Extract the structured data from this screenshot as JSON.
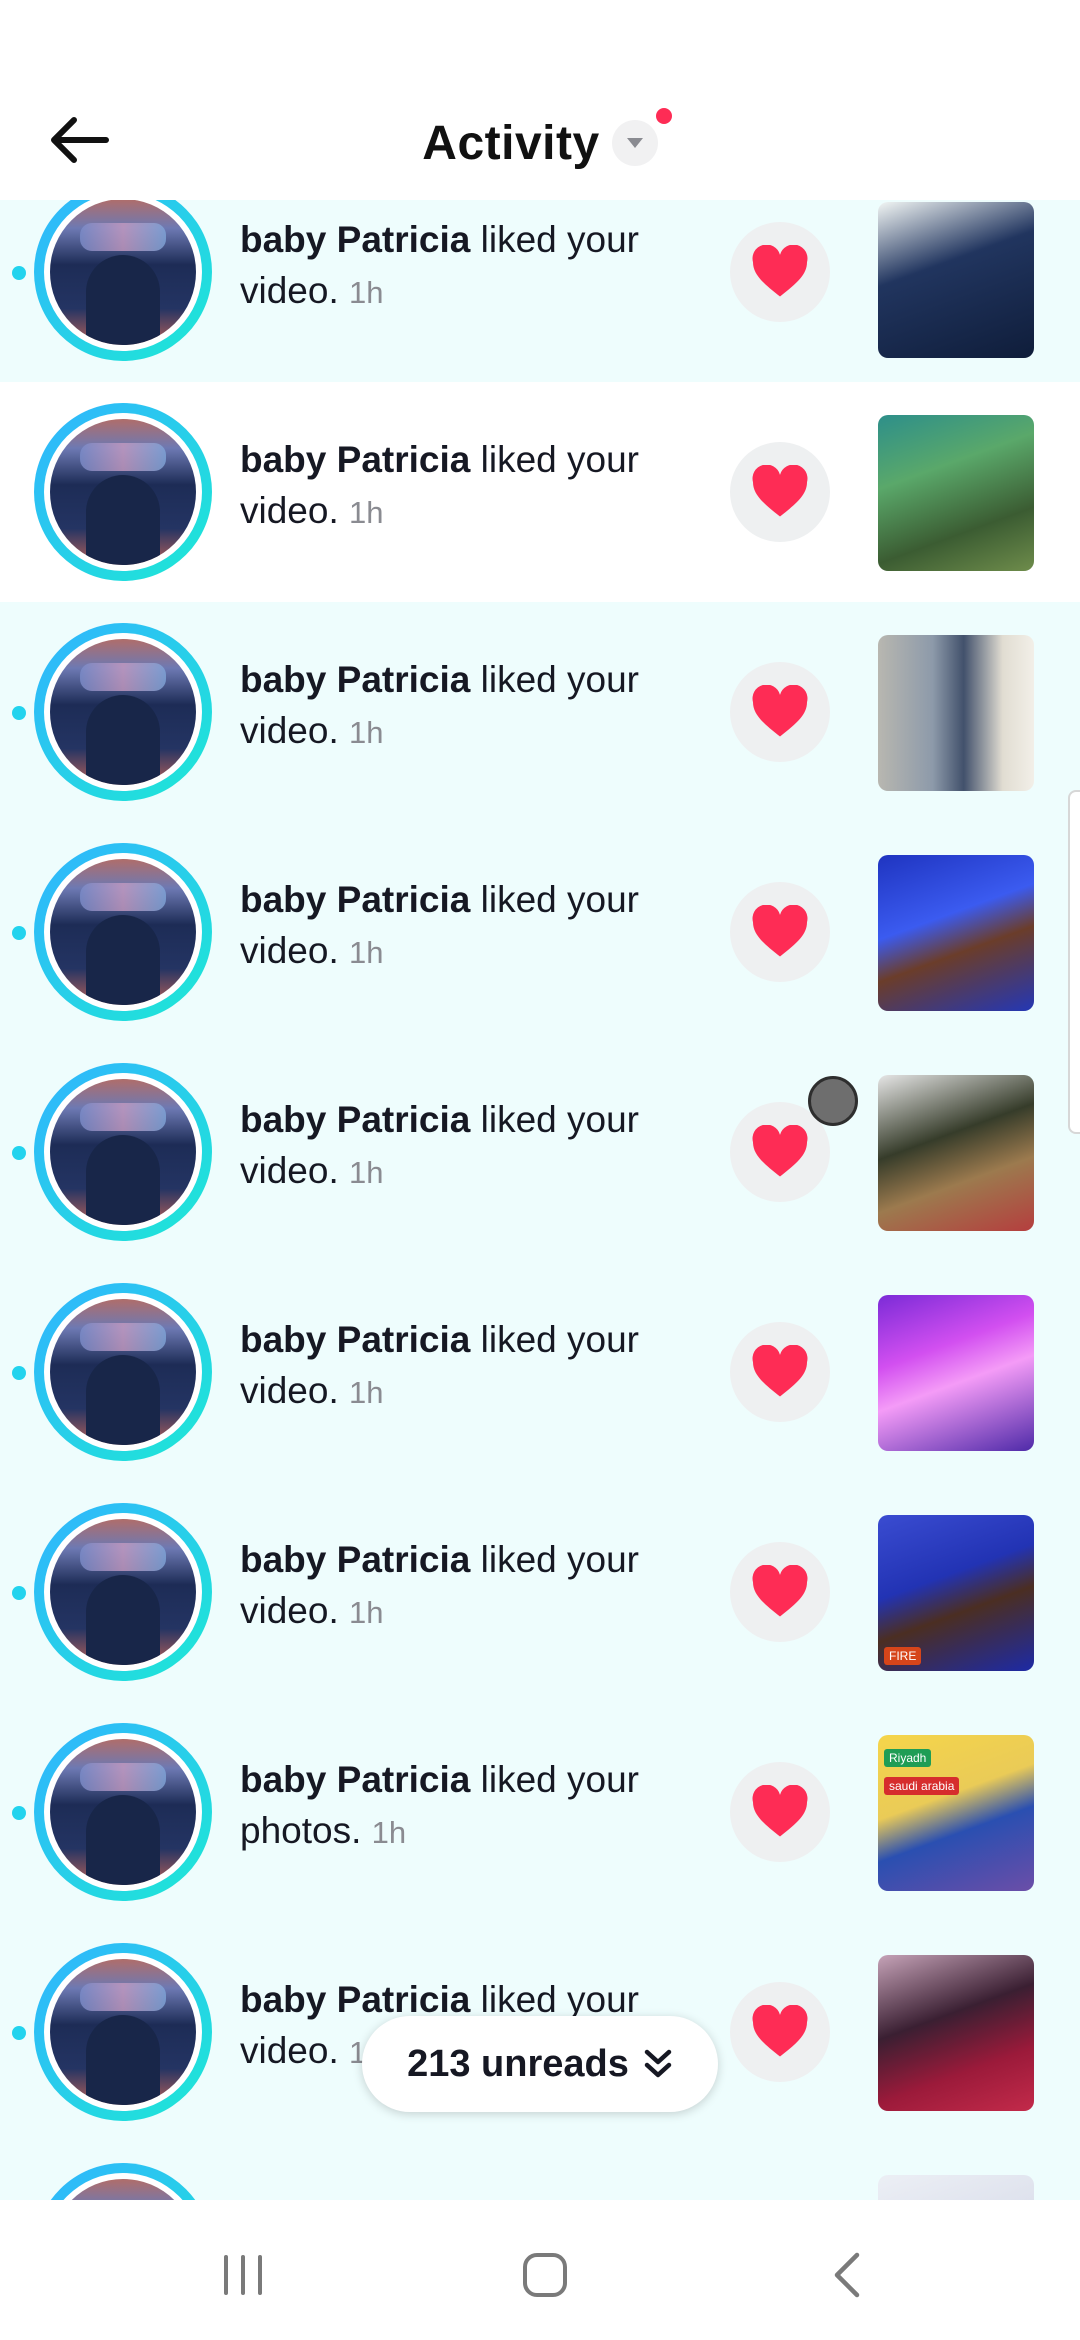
{
  "header": {
    "title": "Activity",
    "back_icon": "arrow-left-icon",
    "caret_icon": "caret-down-icon",
    "notification_dot_color": "#fe2c55"
  },
  "notifications": [
    {
      "user": "baby  Patricia",
      "action": "liked your",
      "object": "video.",
      "time": "1h",
      "unread": true
    },
    {
      "user": "baby  Patricia",
      "action": "liked your",
      "object": "video.",
      "time": "1h",
      "unread": false
    },
    {
      "user": "baby  Patricia",
      "action": "liked your",
      "object": "video.",
      "time": "1h",
      "unread": true
    },
    {
      "user": "baby  Patricia",
      "action": "liked your",
      "object": "video.",
      "time": "1h",
      "unread": true
    },
    {
      "user": "baby  Patricia",
      "action": "liked your",
      "object": "video.",
      "time": "1h",
      "unread": true
    },
    {
      "user": "baby  Patricia",
      "action": "liked your",
      "object": "video.",
      "time": "1h",
      "unread": true
    },
    {
      "user": "baby  Patricia",
      "action": "liked your",
      "object": "video.",
      "time": "1h",
      "unread": true
    },
    {
      "user": "baby  Patricia",
      "action": "liked your",
      "object": "photos.",
      "time": "1h",
      "unread": true,
      "thumb_labels": [
        "Riyadh",
        "saudi arabia"
      ]
    },
    {
      "user": "baby  Patricia",
      "action": "liked your",
      "object": "video.",
      "time": "1h",
      "unread": true
    }
  ],
  "thumb_labels": {
    "row7": "FIRE",
    "row8_a": "Riyadh",
    "row8_b": "saudi arabia"
  },
  "unread_pill": {
    "label": "213 unreads",
    "icon": "double-chevron-down-icon"
  },
  "colors": {
    "unread_row_bg": "#eefdfd",
    "like_red": "#fe2c55",
    "avatar_ring": "#1de9d4"
  },
  "system_nav": {
    "recents_icon": "recent-apps-icon",
    "home_icon": "home-icon",
    "back_icon": "system-back-icon"
  }
}
